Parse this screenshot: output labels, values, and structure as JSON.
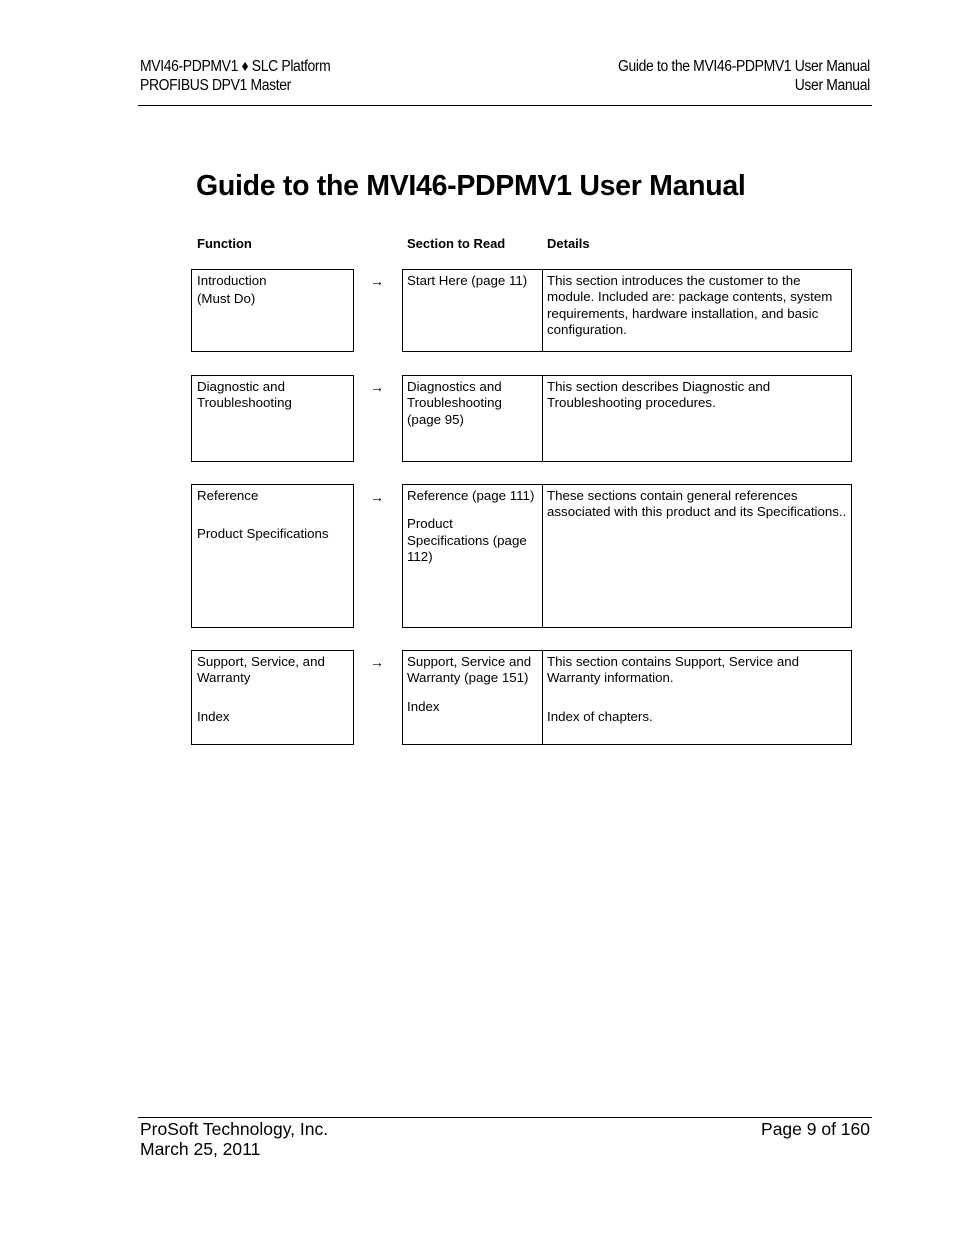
{
  "header": {
    "left_line1": "MVI46-PDPMV1 ♦ SLC Platform",
    "left_line2": "PROFIBUS DPV1 Master",
    "right_line1": "Guide to the MVI46-PDPMV1 User Manual",
    "right_line2": "User Manual"
  },
  "title": "Guide to the MVI46-PDPMV1 User Manual",
  "columns": {
    "function": "Function",
    "section": "Section to Read",
    "details": "Details"
  },
  "arrow": "→",
  "rows": [
    {
      "function": [
        "Introduction",
        "(Must Do)"
      ],
      "section": [
        "Start Here (page 11)"
      ],
      "details": [
        "This section introduces the customer to the module. Included are: package contents, system requirements, hardware installation, and basic configuration."
      ]
    },
    {
      "function": [
        "Diagnostic and Troubleshooting"
      ],
      "section": [
        "Diagnostics and Troubleshooting (page 95)"
      ],
      "details": [
        "This section describes Diagnostic and Troubleshooting procedures."
      ]
    },
    {
      "function": [
        "Reference",
        "Product Specifications"
      ],
      "section": [
        "Reference (page 111)",
        "Product Specifications (page 112)"
      ],
      "details": [
        "These sections contain general references associated with this product and its Specifications.."
      ]
    },
    {
      "function": [
        "Support, Service, and Warranty",
        "Index"
      ],
      "section": [
        "Support, Service and Warranty (page 151)",
        "Index"
      ],
      "details": [
        "This section contains Support, Service and Warranty information.",
        "Index of chapters."
      ]
    }
  ],
  "footer": {
    "company": "ProSoft Technology, Inc.",
    "date": "March 25, 2011",
    "page": "Page 9 of 160"
  }
}
